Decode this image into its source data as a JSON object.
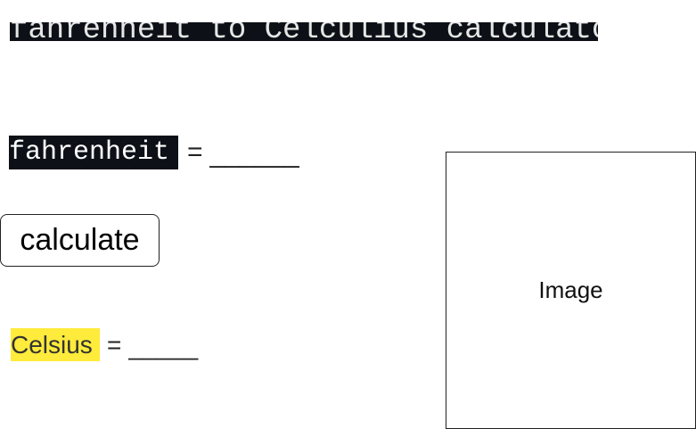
{
  "title": "fahrenheit to Celculius calculator",
  "input_row": {
    "label": "fahrenheit",
    "equals": "=",
    "blank": "______"
  },
  "button": {
    "label": "calculate"
  },
  "output_row": {
    "label": "Celsius",
    "equals": "=",
    "blank": "_____"
  },
  "image_placeholder": {
    "label": "Image"
  },
  "colors": {
    "title_bg": "#0d1117",
    "label_dark_bg": "#0d1117",
    "celsius_highlight": "#ffeb3b"
  }
}
